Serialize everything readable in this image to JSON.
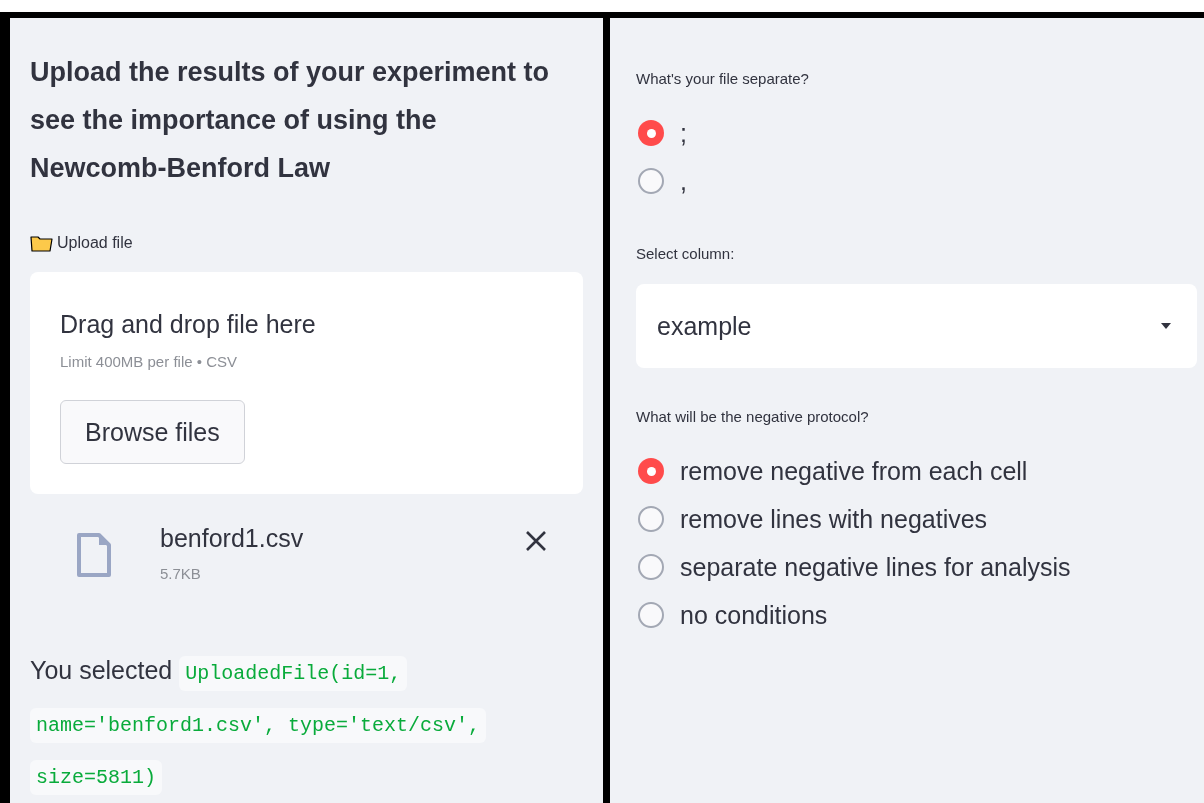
{
  "left": {
    "title": "Upload the results of your experiment to see the importance of using the Newcomb-Benford Law",
    "uploader": {
      "label": "Upload file",
      "dropzone_text": "Drag and drop file here",
      "limit_text": "Limit 400MB per file • CSV",
      "browse_button": "Browse files",
      "file": {
        "name": "benford1.csv",
        "size": "5.7KB"
      }
    },
    "selection": {
      "prefix": "You selected",
      "code_lines": [
        "UploadedFile(id=1,",
        "name='benford1.csv', type='text/csv',",
        "size=5811)"
      ]
    }
  },
  "right": {
    "separator": {
      "label": "What's your file separate?",
      "options": [
        {
          "label": ";",
          "selected": true
        },
        {
          "label": ",",
          "selected": false
        }
      ]
    },
    "column_select": {
      "label": "Select column:",
      "value": "example"
    },
    "negative_protocol": {
      "label": "What will be the negative protocol?",
      "options": [
        {
          "label": "remove negative from each cell",
          "selected": true
        },
        {
          "label": "remove lines with negatives",
          "selected": false
        },
        {
          "label": "separate negative lines for analysis",
          "selected": false
        },
        {
          "label": "no conditions",
          "selected": false
        }
      ]
    }
  }
}
